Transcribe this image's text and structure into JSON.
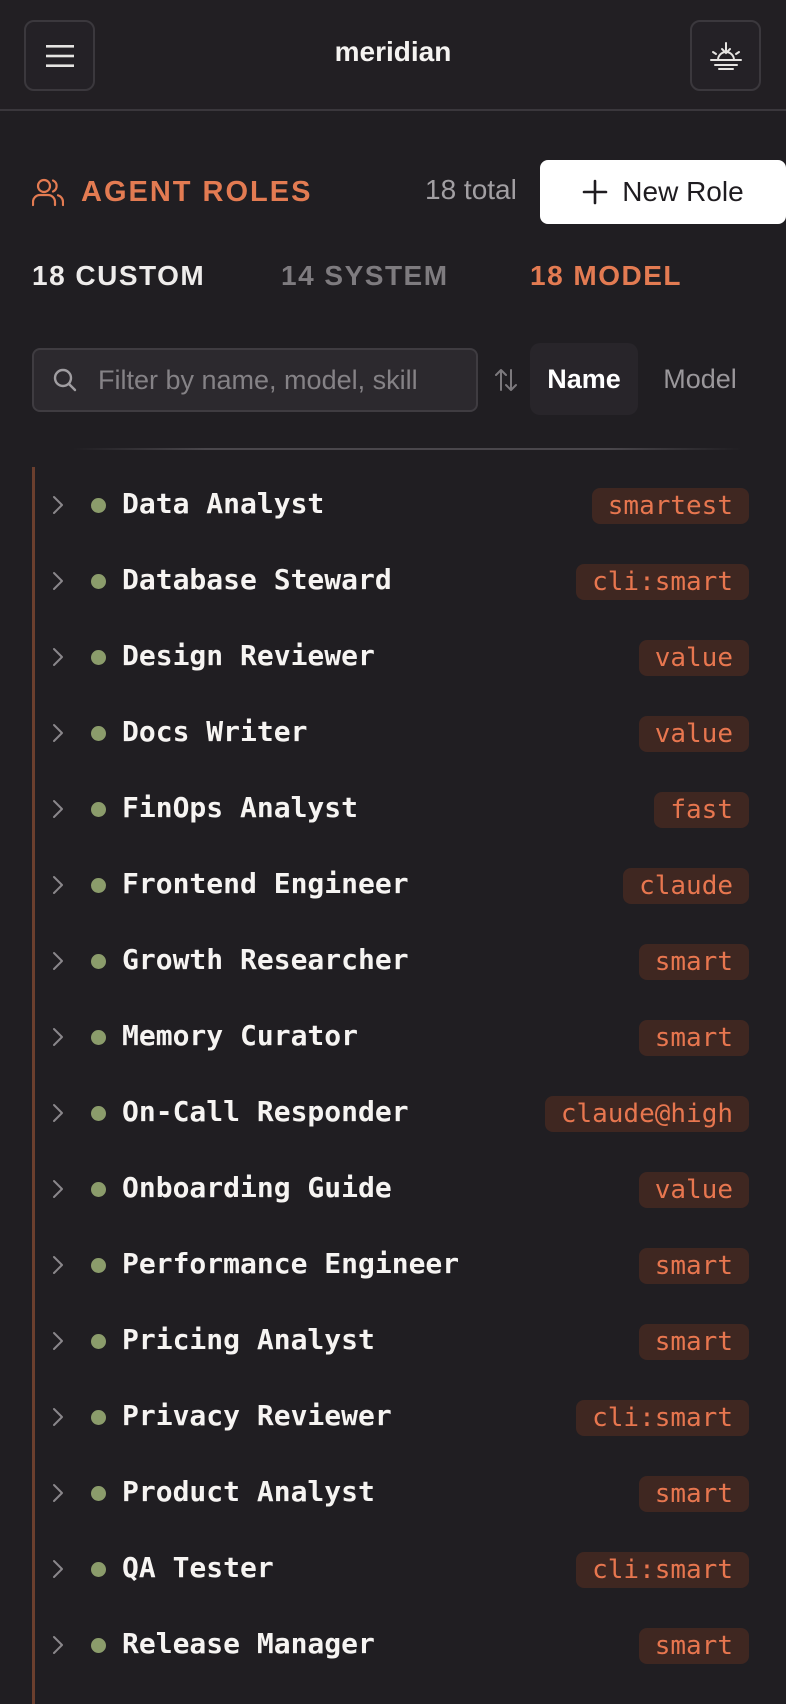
{
  "app": {
    "title": "meridian",
    "menu_icon": "hamburger-menu-icon",
    "download_icon": "sunrise-download-icon"
  },
  "section": {
    "icon": "users-icon",
    "title": "AGENT ROLES",
    "total": "18 total",
    "new_role_label": "New Role"
  },
  "tabs": {
    "custom": "18 CUSTOM",
    "system": "14 SYSTEM",
    "model": "18 MODEL"
  },
  "filter": {
    "placeholder": "Filter by name, model, skill",
    "value": ""
  },
  "sort": {
    "name_label": "Name",
    "model_label": "Model",
    "active": "Name"
  },
  "colors": {
    "accent": "#e37b52",
    "background": "#201e22",
    "status_dot": "#8b9c6b",
    "badge_bg": "#3f2721"
  },
  "roles": [
    {
      "name": "Data Analyst",
      "model": "smartest"
    },
    {
      "name": "Database Steward",
      "model": "cli:smart"
    },
    {
      "name": "Design Reviewer",
      "model": "value"
    },
    {
      "name": "Docs Writer",
      "model": "value"
    },
    {
      "name": "FinOps Analyst",
      "model": "fast"
    },
    {
      "name": "Frontend Engineer",
      "model": "claude"
    },
    {
      "name": "Growth Researcher",
      "model": "smart"
    },
    {
      "name": "Memory Curator",
      "model": "smart"
    },
    {
      "name": "On-Call Responder",
      "model": "claude@high"
    },
    {
      "name": "Onboarding Guide",
      "model": "value"
    },
    {
      "name": "Performance Engineer",
      "model": "smart"
    },
    {
      "name": "Pricing Analyst",
      "model": "smart"
    },
    {
      "name": "Privacy Reviewer",
      "model": "cli:smart"
    },
    {
      "name": "Product Analyst",
      "model": "smart"
    },
    {
      "name": "QA Tester",
      "model": "cli:smart"
    },
    {
      "name": "Release Manager",
      "model": "smart"
    }
  ]
}
